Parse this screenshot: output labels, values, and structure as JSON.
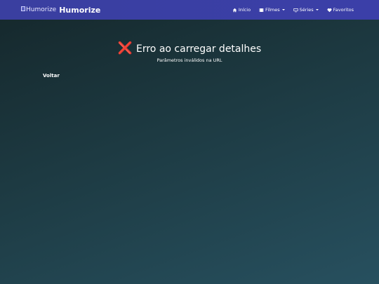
{
  "navbar": {
    "logo_alt": "Humorize",
    "brand": "Humorize",
    "items": [
      {
        "label": "Início",
        "icon": "home-icon"
      },
      {
        "label": "Filmes",
        "icon": "film-icon",
        "dropdown": true
      },
      {
        "label": "Séries",
        "icon": "tv-icon",
        "dropdown": true
      },
      {
        "label": "Favoritos",
        "icon": "heart-icon"
      }
    ]
  },
  "main": {
    "error_icon": "❌",
    "error_title": "Erro ao carregar detalhes",
    "error_message": "Parâmetros inválidos na URL",
    "back_label": "Voltar"
  },
  "colors": {
    "navbar": "#3b3fa8",
    "error_icon": "#e8342f"
  }
}
